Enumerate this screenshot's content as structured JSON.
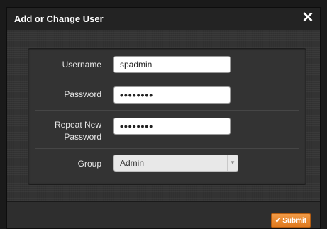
{
  "dialog": {
    "title": "Add or Change User",
    "close_glyph": "✕"
  },
  "form": {
    "username": {
      "label": "Username",
      "value": "spadmin"
    },
    "password": {
      "label": "Password",
      "value": "••••••••"
    },
    "repeat_password": {
      "label_line1": "Repeat New",
      "label_line2": "Password",
      "value": "••••••••"
    },
    "group": {
      "label": "Group",
      "selected": "Admin"
    }
  },
  "footer": {
    "submit_label": "Submit",
    "submit_icon": "check-icon",
    "submit_color": "#e8812b"
  }
}
